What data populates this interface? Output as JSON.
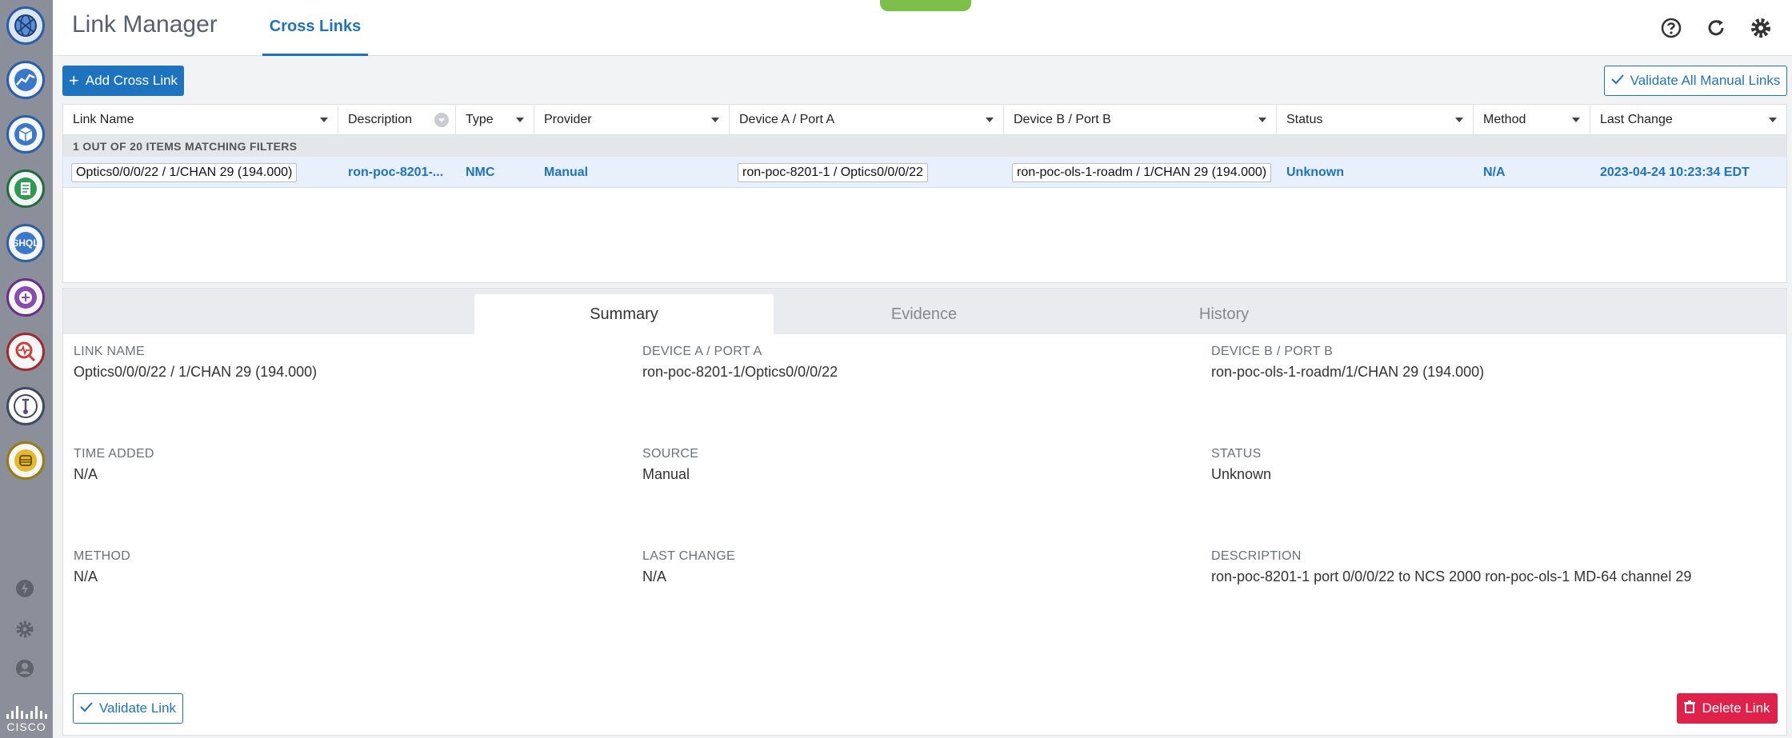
{
  "header": {
    "app_title": "Link Manager",
    "active_tab": "Cross Links"
  },
  "toolbar": {
    "add_label": "Add Cross Link",
    "validate_all_label": "Validate All Manual Links"
  },
  "table": {
    "columns": [
      "Link Name",
      "Description",
      "Type",
      "Provider",
      "Device A / Port A",
      "Device B / Port B",
      "Status",
      "Method",
      "Last Change"
    ],
    "filter_summary": "1 OUT OF 20 ITEMS MATCHING FILTERS",
    "rows": [
      {
        "link_name": "Optics0/0/0/22 / 1/CHAN 29 (194.000)",
        "description": "ron-poc-8201-...",
        "type": "NMC",
        "provider": "Manual",
        "device_a": "ron-poc-8201-1 / Optics0/0/0/22",
        "device_b": "ron-poc-ols-1-roadm / 1/CHAN 29 (194.000)",
        "status": "Unknown",
        "method": "N/A",
        "last_change": "2023-04-24 10:23:34 EDT"
      }
    ]
  },
  "details": {
    "tabs": [
      "Summary",
      "Evidence",
      "History"
    ],
    "fields": {
      "link_name": {
        "label": "LINK NAME",
        "value": "Optics0/0/0/22 / 1/CHAN 29 (194.000)"
      },
      "device_a": {
        "label": "DEVICE A / PORT A",
        "value": "ron-poc-8201-1/Optics0/0/0/22"
      },
      "device_b": {
        "label": "DEVICE B / PORT B",
        "value": "ron-poc-ols-1-roadm/1/CHAN 29 (194.000)"
      },
      "time_added": {
        "label": "TIME ADDED",
        "value": "N/A"
      },
      "source": {
        "label": "SOURCE",
        "value": "Manual"
      },
      "status": {
        "label": "STATUS",
        "value": "Unknown"
      },
      "method": {
        "label": "METHOD",
        "value": "N/A"
      },
      "last_change": {
        "label": "LAST CHANGE",
        "value": "N/A"
      },
      "description": {
        "label": "DESCRIPTION",
        "value": "ron-poc-8201-1 port 0/0/0/22 to NCS 2000 ron-poc-ols-1 MD-64 channel 29"
      }
    },
    "validate_label": "Validate Link",
    "delete_label": "Delete Link"
  },
  "sidebar": {
    "logo_text": "CISCO",
    "items": [
      "globe-icon",
      "trend-chart-icon",
      "cube-icon",
      "document-icon",
      "shql-icon",
      "spiral-plus-icon",
      "health-search-icon",
      "link-manager-icon",
      "data-storage-icon"
    ],
    "shql_text": "SHQL"
  },
  "colors": {
    "accent": "#1e73be",
    "danger": "#e0224b",
    "sidebar": "#8a8f99",
    "green_pill": "#7cc04b"
  }
}
